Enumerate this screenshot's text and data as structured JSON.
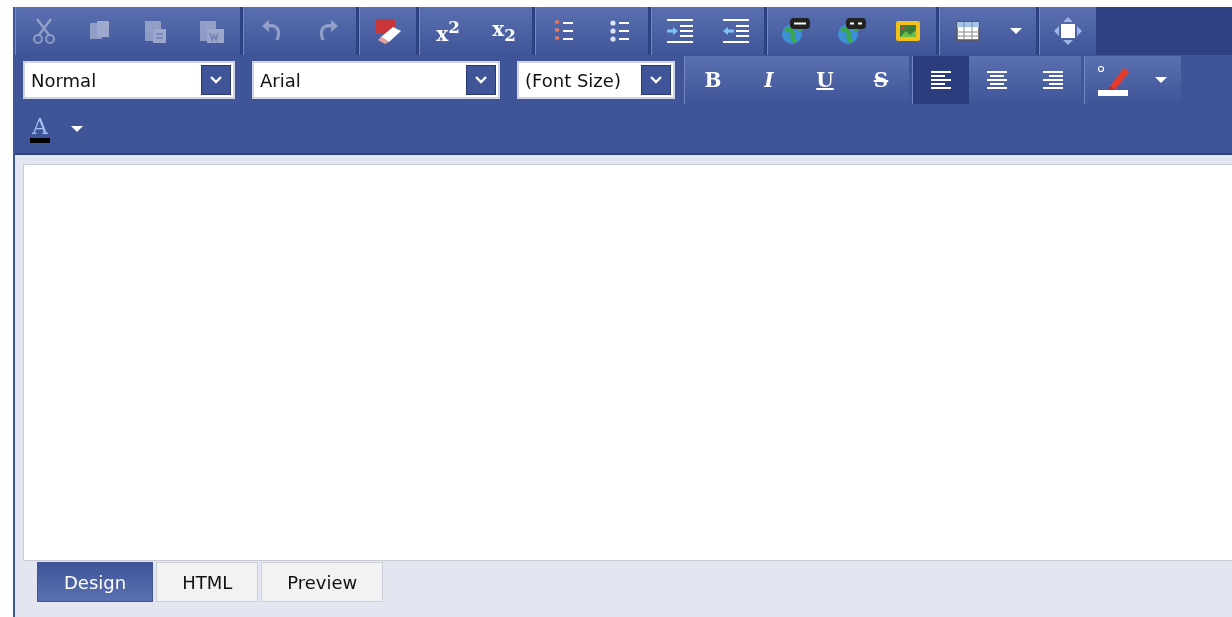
{
  "toolbar": {
    "rows": [
      {
        "groups": [
          {
            "kind": "buttons",
            "buttons": [
              {
                "kind": "cut",
                "disabled": true
              },
              {
                "kind": "copy",
                "disabled": true
              },
              {
                "kind": "paste",
                "disabled": true
              },
              {
                "kind": "paste-word",
                "disabled": true
              }
            ]
          },
          {
            "kind": "buttons",
            "buttons": [
              {
                "kind": "undo",
                "disabled": true
              },
              {
                "kind": "redo",
                "disabled": true
              }
            ]
          },
          {
            "kind": "buttons",
            "buttons": [
              {
                "kind": "spellcheck",
                "disabled": false
              }
            ]
          },
          {
            "kind": "buttons",
            "buttons": [
              {
                "kind": "superscript",
                "label": "x$^{2}$",
                "disabled": false
              },
              {
                "kind": "subscript",
                "label": "x$_{2}$",
                "disabled": false
              }
            ]
          },
          {
            "kind": "buttons",
            "buttons": [
              {
                "kind": "ordered-list",
                "disabled": false
              },
              {
                "kind": "bullet-list",
                "disabled": false
              }
            ]
          },
          {
            "kind": "buttons",
            "buttons": [
              {
                "kind": "indent",
                "disabled": false
              },
              {
                "kind": "outdent",
                "disabled": false
              }
            ]
          },
          {
            "kind": "buttons",
            "buttons": [
              {
                "kind": "link",
                "disabled": false
              },
              {
                "kind": "unlink",
                "disabled": false
              },
              {
                "kind": "image",
                "disabled": false
              }
            ]
          },
          {
            "kind": "buttons",
            "buttons": [
              {
                "kind": "table",
                "disabled": false
              },
              {
                "kind": "caret",
                "disabled": false
              }
            ]
          },
          {
            "kind": "buttons",
            "buttons": [
              {
                "kind": "resize",
                "disabled": false
              }
            ]
          }
        ]
      },
      {
        "groups": [
          {
            "kind": "select",
            "value": "Normal"
          },
          {
            "kind": "select",
            "value": "Arial"
          },
          {
            "kind": "select",
            "value": "(Font Size)"
          },
          {
            "kind": "buttons",
            "buttons": [
              {
                "kind": "bold",
                "label": "B",
                "disabled": false
              },
              {
                "kind": "italic",
                "label": "I",
                "disabled": false
              },
              {
                "kind": "underline",
                "label": "U",
                "disabled": false
              },
              {
                "kind": "strike",
                "label": "S",
                "disabled": false
              }
            ]
          },
          {
            "kind": "buttons",
            "buttons": [
              {
                "kind": "align-left",
                "selected": true
              },
              {
                "kind": "align-center",
                "selected": false
              },
              {
                "kind": "align-right",
                "selected": false
              }
            ]
          },
          {
            "kind": "buttons",
            "buttons": [
              {
                "kind": "highlight",
                "disabled": false
              },
              {
                "kind": "caret",
                "disabled": false
              }
            ]
          }
        ]
      },
      {
        "groups": [
          {
            "kind": "plain",
            "buttons": [
              {
                "kind": "font-color",
                "label": "A",
                "disabled": false
              },
              {
                "kind": "caret",
                "disabled": false
              }
            ]
          }
        ]
      }
    ]
  },
  "tabs": [
    {
      "label": "Design",
      "selected": true
    },
    {
      "label": "HTML",
      "selected": false
    },
    {
      "label": "Preview",
      "selected": false
    }
  ]
}
